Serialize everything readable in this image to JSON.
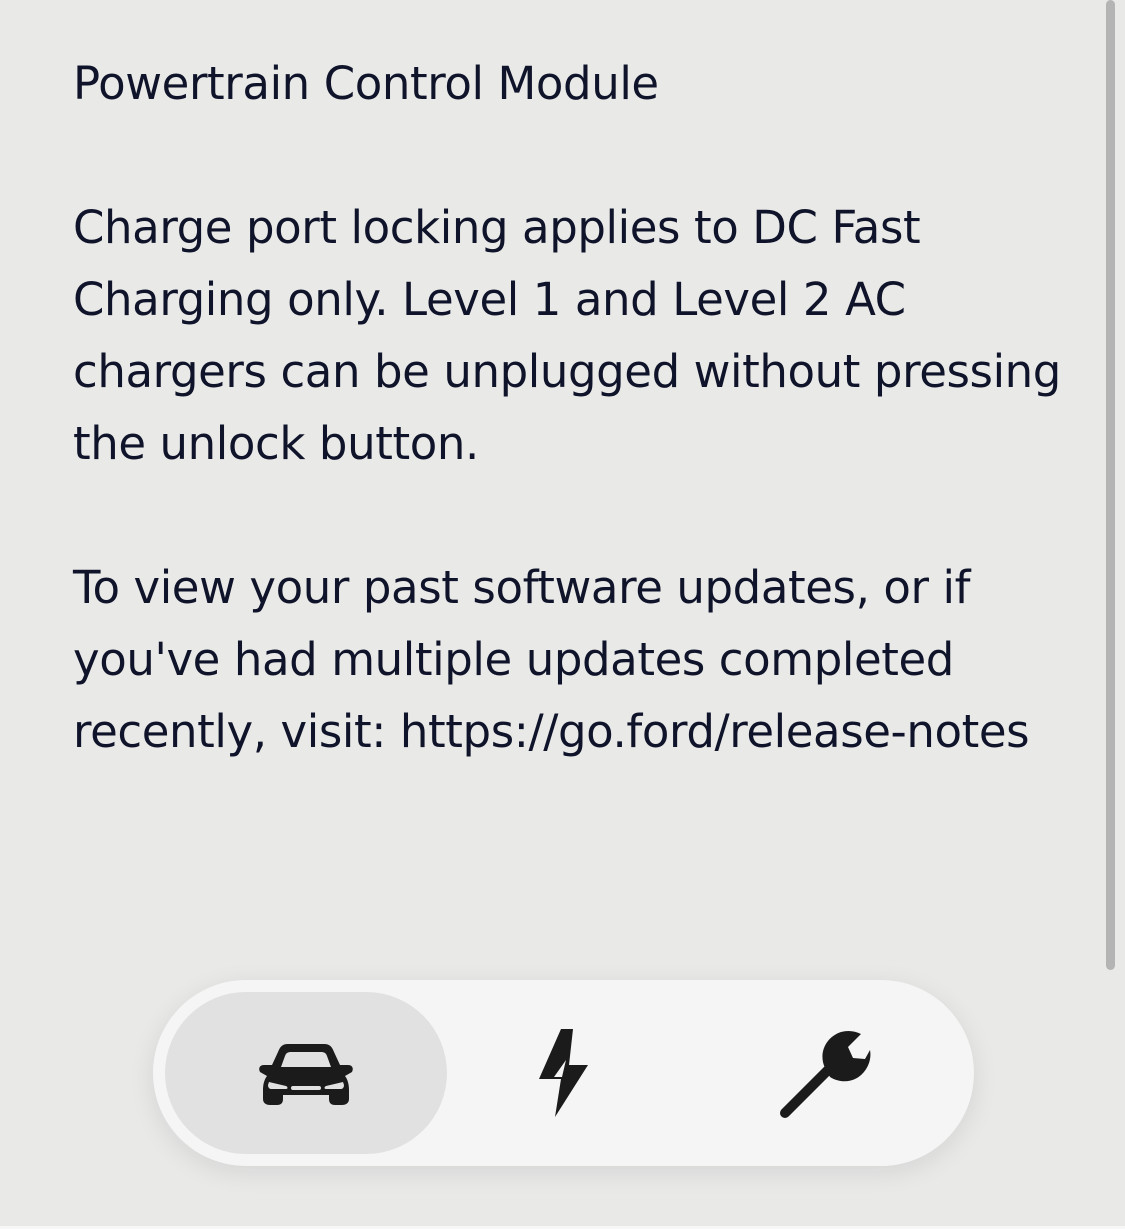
{
  "content": {
    "module_title": "Powertrain Control Module",
    "charge_port_note": "Charge port locking applies to DC Fast Charging only. Level 1 and Level 2 AC chargers can be unplugged without pressing the unlock button.",
    "release_notes_note": "To view your past software updates, or if you've had multiple updates completed recently, visit: https://go.ford/release-notes"
  },
  "tabbar": {
    "tabs": [
      {
        "icon": "car-icon",
        "active": true
      },
      {
        "icon": "lightning-bolt-icon",
        "active": false
      },
      {
        "icon": "wrench-icon",
        "active": false
      }
    ]
  },
  "colors": {
    "background": "#e9e9e8",
    "text": "#10142a",
    "tabbar": "#f5f5f5",
    "active_tab": "#e1e1e1",
    "icon": "#1b1b1b"
  }
}
